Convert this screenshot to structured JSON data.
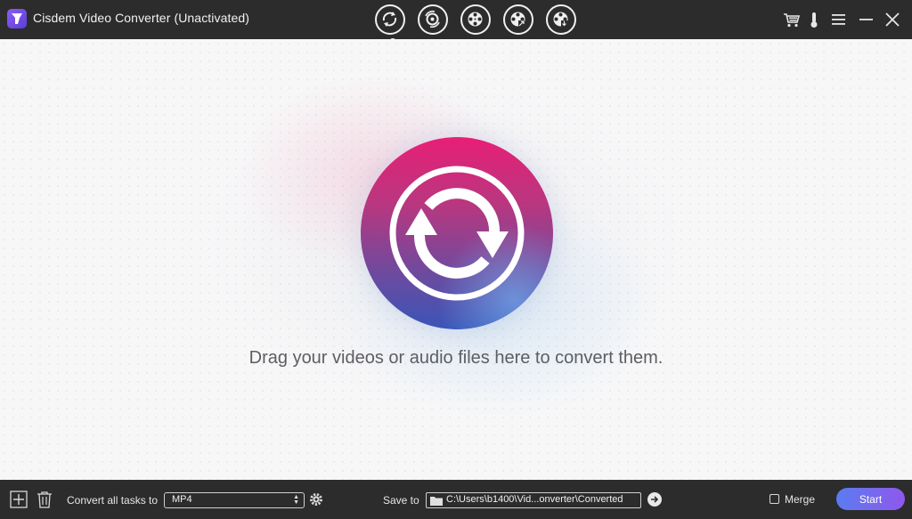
{
  "app": {
    "title": "Cisdem Video Converter (Unactivated)"
  },
  "titlebar": {
    "modes": [
      {
        "icon": "convert-icon"
      },
      {
        "icon": "rip-icon"
      },
      {
        "icon": "film-reel-icon"
      },
      {
        "icon": "film-reel-compress-icon"
      },
      {
        "icon": "film-reel-download-icon"
      }
    ],
    "actions": [
      "cart-icon",
      "thermometer-icon",
      "menu-icon",
      "minimize-icon",
      "close-icon"
    ]
  },
  "drop_area": {
    "hint": "Drag your videos or audio files here to convert them."
  },
  "bottombar": {
    "convert_all_label": "Convert all tasks to",
    "format_value": "MP4",
    "save_to_label": "Save to",
    "save_path": "C:\\Users\\b1400\\Vid...onverter\\Converted",
    "merge_label": "Merge",
    "start_label": "Start"
  },
  "colors": {
    "bar_bg": "#2c2c2c",
    "orb_top": "#e81f76",
    "orb_bottom": "#3955b8",
    "start_gradient_start": "#5a7cf0",
    "start_gradient_end": "#8f58ec"
  }
}
